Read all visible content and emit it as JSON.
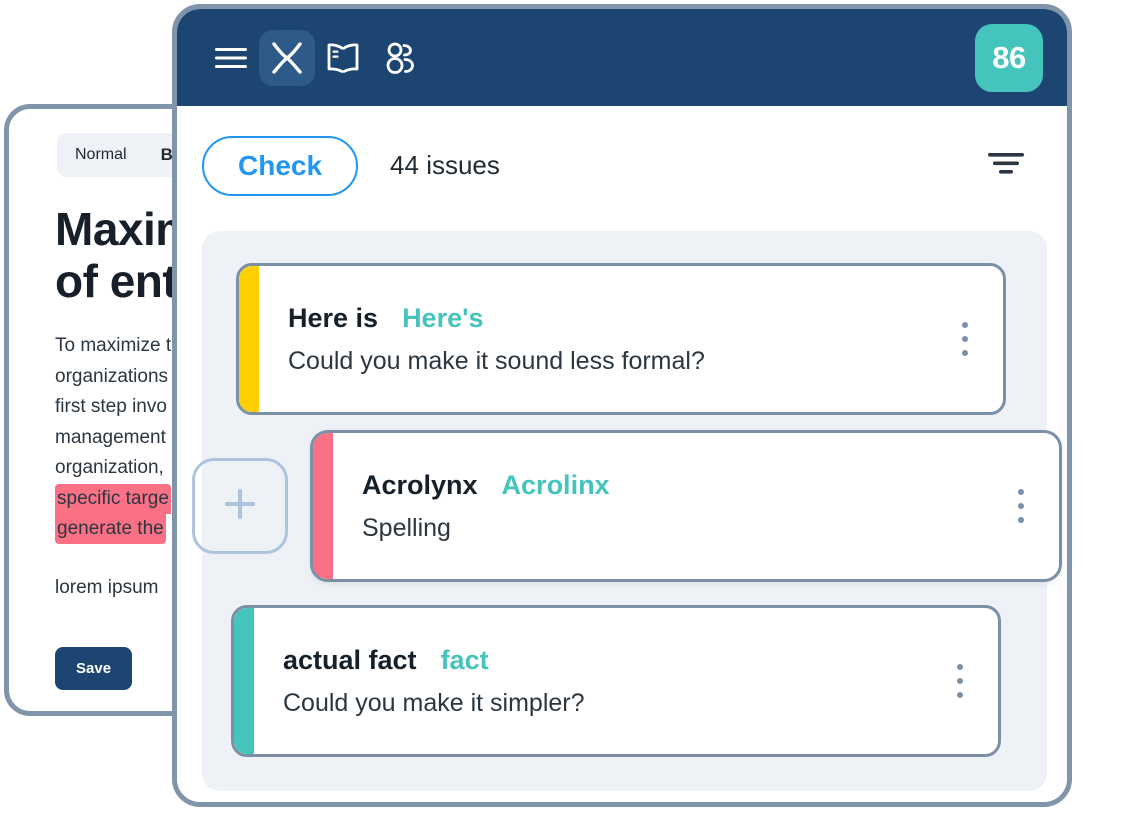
{
  "document_window": {
    "toolbar": {
      "style_label": "Normal",
      "bold_label": "B"
    },
    "heading_lines": [
      "Maxim",
      "of ent"
    ],
    "body_lines": [
      "To maximize t",
      "organizations",
      "first step invo",
      "management",
      "organization, "
    ],
    "highlighted_lines": [
      "specific targe",
      "generate the "
    ],
    "trailing_line": "lorem ipsum ",
    "save_label": "Save"
  },
  "sidebar": {
    "topbar": {
      "menu_icon": "hamburger-menu-icon",
      "brand_icon": "acrolinx-x-logo-icon",
      "guide_icon": "open-book-icon",
      "audience_icon": "users-group-icon",
      "score": "86"
    },
    "actions": {
      "check_label": "Check",
      "issues_label": "44 issues",
      "filter_icon": "filter-icon"
    },
    "add_button_label": "+",
    "issues": [
      {
        "accent_color": "#FFD000",
        "original": "Here is",
        "suggestion": "Here's",
        "note": "Could you make it sound less formal?"
      },
      {
        "accent_color": "#FA7084",
        "original": "Acrolynx",
        "suggestion": "Acrolinx",
        "note": "Spelling"
      },
      {
        "accent_color": "#45C4BD",
        "original": "actual fact",
        "suggestion": "fact",
        "note": "Could you make it simpler?"
      }
    ]
  },
  "colors": {
    "navy": "#1C4671",
    "teal": "#45C4BD",
    "blue": "#2196F3",
    "yellow": "#FFD000",
    "pink": "#FA7084",
    "panel_bg": "#EEF2F6",
    "border": "#7B8FA6"
  }
}
